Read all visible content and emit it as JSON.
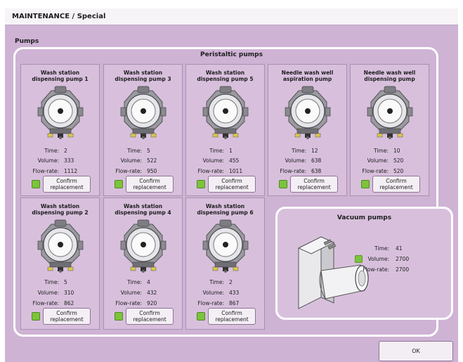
{
  "window": {
    "title": "MAINTENANCE / Special"
  },
  "section": {
    "label": "Pumps"
  },
  "peristaltic": {
    "label": "Peristaltic pumps",
    "pumps": [
      {
        "name_line1": "Wash station",
        "name_line2": "dispensing pump 1",
        "time": "2",
        "volume": "333",
        "flow_rate": "1112"
      },
      {
        "name_line1": "Wash station",
        "name_line2": "dispensing pump 3",
        "time": "5",
        "volume": "522",
        "flow_rate": "950"
      },
      {
        "name_line1": "Wash station",
        "name_line2": "dispensing pump 5",
        "time": "1",
        "volume": "455",
        "flow_rate": "1011"
      },
      {
        "name_line1": "Needle wash well",
        "name_line2": "aspiration pump",
        "time": "12",
        "volume": "638",
        "flow_rate": "638"
      },
      {
        "name_line1": "Needle wash well",
        "name_line2": "dispensing pump",
        "time": "10",
        "volume": "520",
        "flow_rate": "520"
      },
      {
        "name_line1": "Wash station",
        "name_line2": "dispensing pump 2",
        "time": "5",
        "volume": "310",
        "flow_rate": "862"
      },
      {
        "name_line1": "Wash station",
        "name_line2": "dispensing pump 4",
        "time": "4",
        "volume": "432",
        "flow_rate": "920"
      },
      {
        "name_line1": "Wash station",
        "name_line2": "dispensing pump 6",
        "time": "2",
        "volume": "433",
        "flow_rate": "867"
      }
    ]
  },
  "labels": {
    "time": "Time:",
    "volume": "Volume:",
    "flow_rate": "Flow-rate:",
    "confirm_line1": "Confirm",
    "confirm_line2": "replacement"
  },
  "vacuum": {
    "label": "Vacuum pumps",
    "time": "41",
    "volume": "2700",
    "flow_rate": "2700"
  },
  "ok_button": {
    "label": "OK"
  },
  "colors": {
    "background": "#cfb3d5",
    "card": "#d8c0dd",
    "status_ok": "#7cc43a",
    "panel_border": "#ffffff"
  },
  "icons": {
    "pump": "peristaltic-pump-icon",
    "vacuum": "vacuum-pump-icon",
    "status": "status-led-icon"
  }
}
